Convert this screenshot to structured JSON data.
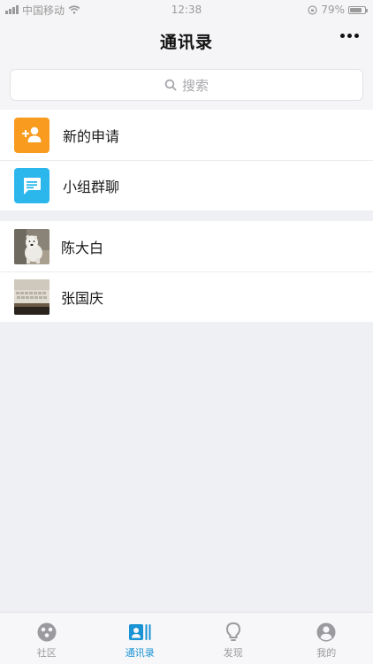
{
  "status_bar": {
    "carrier": "中国移动",
    "time": "12:38",
    "battery": "79%",
    "battery_level": 0.79
  },
  "header": {
    "title": "通讯录"
  },
  "search": {
    "placeholder": "搜索"
  },
  "functions": [
    {
      "label": "新的申请",
      "icon": "add-friend-icon",
      "color": "#F89B1F"
    },
    {
      "label": "小组群聊",
      "icon": "group-chat-icon",
      "color": "#2BB7EC"
    }
  ],
  "contacts": [
    {
      "name": "陈大白",
      "avatar": "polar-bear-photo"
    },
    {
      "name": "张国庆",
      "avatar": "keyboard-photo"
    }
  ],
  "tabs": [
    {
      "label": "社区",
      "icon": "community-icon",
      "active": false
    },
    {
      "label": "通讯录",
      "icon": "contacts-icon",
      "active": true
    },
    {
      "label": "发现",
      "icon": "lightbulb-icon",
      "active": false
    },
    {
      "label": "我的",
      "icon": "profile-icon",
      "active": false
    }
  ],
  "colors": {
    "accent": "#1A93D4",
    "inactive": "#9B9B9F",
    "background": "#EFF0F4"
  }
}
